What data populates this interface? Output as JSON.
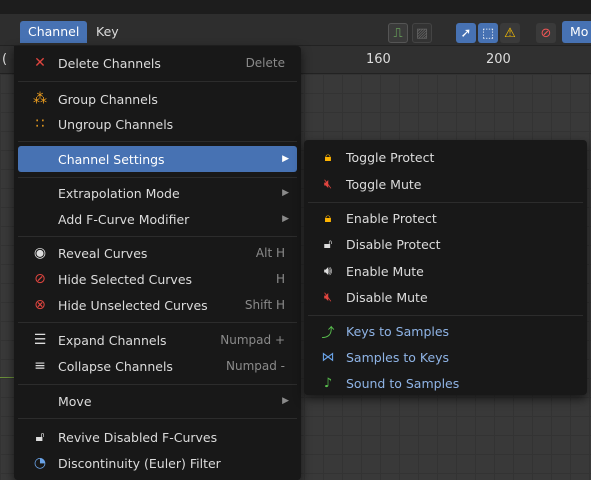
{
  "header": {
    "menus": [
      {
        "label": "Channel"
      },
      {
        "label": "Key"
      }
    ],
    "mode_label": "Mo",
    "icons": [
      "normalize-icon",
      "handles-icon",
      "cursor-icon",
      "box-select-icon",
      "warning-icon",
      "filter-icon"
    ]
  },
  "ruler": {
    "ticks": [
      "160",
      "200"
    ],
    "left_partial": "("
  },
  "main_menu": {
    "items": [
      {
        "label": "Delete Channels",
        "shortcut": "Delete",
        "icon": "x-delete-icon"
      },
      {
        "label": "Group Channels",
        "shortcut": "",
        "icon": "group-icon"
      },
      {
        "label": "Ungroup Channels",
        "shortcut": "",
        "icon": "ungroup-icon"
      },
      {
        "label": "Channel Settings",
        "shortcut": "",
        "icon": "",
        "submenu": true,
        "active": true
      },
      {
        "label": "Extrapolation Mode",
        "shortcut": "",
        "icon": "",
        "submenu": true
      },
      {
        "label": "Add F-Curve Modifier",
        "shortcut": "",
        "icon": "",
        "submenu": true
      },
      {
        "label": "Reveal Curves",
        "shortcut": "Alt H",
        "icon": "eye-icon"
      },
      {
        "label": "Hide Selected Curves",
        "shortcut": "H",
        "icon": "hide-icon"
      },
      {
        "label": "Hide Unselected Curves",
        "shortcut": "Shift H",
        "icon": "hide-unselected-icon"
      },
      {
        "label": "Expand Channels",
        "shortcut": "Numpad +",
        "icon": "expand-icon"
      },
      {
        "label": "Collapse Channels",
        "shortcut": "Numpad -",
        "icon": "collapse-icon"
      },
      {
        "label": "Move",
        "shortcut": "",
        "icon": "",
        "submenu": true
      },
      {
        "label": "Revive Disabled F-Curves",
        "shortcut": "",
        "icon": "lock-open-icon"
      },
      {
        "label": "Discontinuity (Euler) Filter",
        "shortcut": "",
        "icon": "discontinuity-icon"
      }
    ]
  },
  "submenu": {
    "items": [
      {
        "label": "Toggle Protect",
        "icon": "lock-icon"
      },
      {
        "label": "Toggle Mute",
        "icon": "mute-icon"
      },
      {
        "label": "Enable Protect",
        "icon": "lock-icon"
      },
      {
        "label": "Disable Protect",
        "icon": "lock-open-icon"
      },
      {
        "label": "Enable Mute",
        "icon": "speaker-icon"
      },
      {
        "label": "Disable Mute",
        "icon": "mute-icon"
      },
      {
        "label": "Keys to Samples",
        "icon": "keys-to-samples-icon"
      },
      {
        "label": "Samples to Keys",
        "icon": "samples-to-keys-icon"
      },
      {
        "label": "Sound to Samples",
        "icon": "sound-to-samples-icon"
      }
    ]
  },
  "colors": {
    "accent": "#4772b3",
    "menu_bg": "#181818",
    "delete_red": "#e0453f",
    "group_orange": "#f0a020"
  }
}
